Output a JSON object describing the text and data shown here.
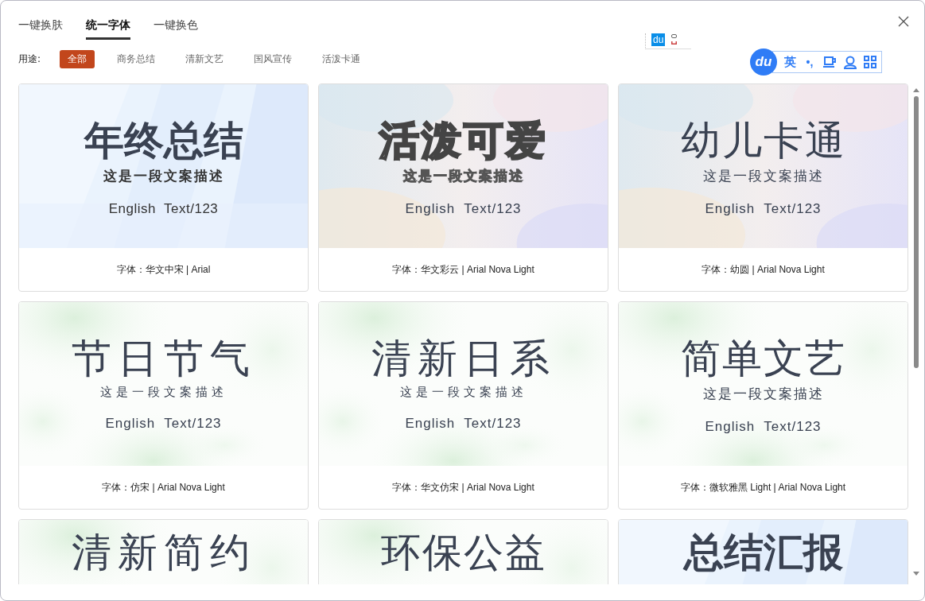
{
  "tabs": [
    {
      "label": "一键换肤",
      "selected": false
    },
    {
      "label": "统一字体",
      "selected": true
    },
    {
      "label": "一键换色",
      "selected": false
    }
  ],
  "filter": {
    "label": "用途:",
    "options": [
      {
        "label": "全部",
        "selected": true
      },
      {
        "label": "商务总结",
        "selected": false
      },
      {
        "label": "清新文艺",
        "selected": false
      },
      {
        "label": "国风宣传",
        "selected": false
      },
      {
        "label": "活泼卡通",
        "selected": false
      }
    ]
  },
  "ime_toolbar": {
    "mini_logo": "du",
    "logo": "du",
    "language": "英",
    "punctuation": "•,"
  },
  "cards": [
    {
      "title": "年终总结",
      "subtitle": "这是一段文案描述",
      "english": "English  Text/123",
      "caption": "字体：华文中宋 | Arial",
      "kind": "bold"
    },
    {
      "title": "活泼可爱",
      "subtitle": "这是一段文案描述",
      "english": "English  Text/123",
      "caption": "字体：华文彩云 | Arial Nova Light",
      "kind": "outline"
    },
    {
      "title": "幼儿卡通",
      "subtitle": "这是一段文案描述",
      "english": "English  Text/123",
      "caption": "字体：幼圆 | Arial Nova Light",
      "kind": "round"
    },
    {
      "title": "节日节气",
      "subtitle": "这是一段文案描述",
      "english": "English  Text/123",
      "caption": "字体：仿宋 | Arial Nova Light",
      "kind": "serif"
    },
    {
      "title": "清新日系",
      "subtitle": "这是一段文案描述",
      "english": "English  Text/123",
      "caption": "字体：华文仿宋 | Arial Nova Light",
      "kind": "serif"
    },
    {
      "title": "简单文艺",
      "subtitle": "这是一段文案描述",
      "english": "English  Text/123",
      "caption": "字体：微软雅黑 Light | Arial Nova Light",
      "kind": "thin"
    },
    {
      "title": "清新简约",
      "kind": "serif"
    },
    {
      "title": "环保公益",
      "kind": "thin"
    },
    {
      "title": "总结汇报",
      "kind": "bold"
    }
  ]
}
